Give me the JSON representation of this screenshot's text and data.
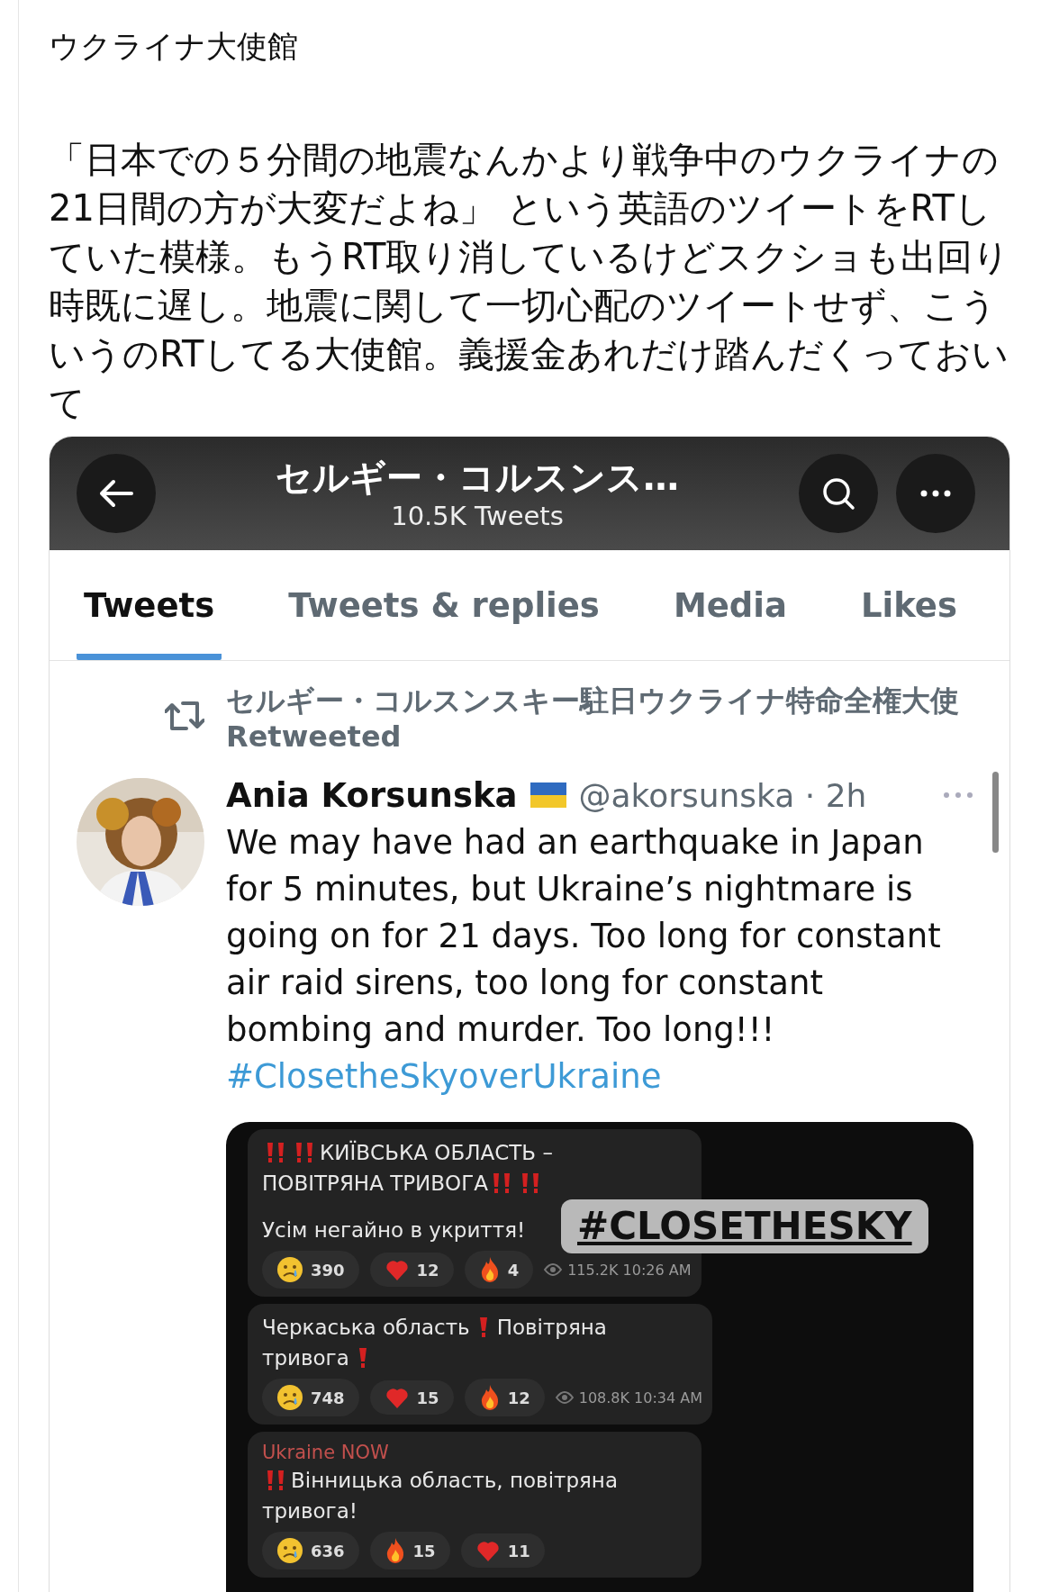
{
  "post": {
    "author": "ウクライナ大使館",
    "body": "「日本での５分間の地震なんかより戦争中のウクライナの21日間の方が大変だよね」 という英語のツイートをRTしていた模様。もうRT取り消しているけどスクショも出回り時既に遅し。地震に関して一切心配のツイートせず、こういうのRTしてる大使館。義援金あれだけ踏んだくっておいて"
  },
  "screenshot": {
    "header": {
      "title": "セルギー・コルスンス…",
      "subtitle": "10.5K Tweets"
    },
    "tabs": [
      {
        "label": "Tweets",
        "selected": true
      },
      {
        "label": "Tweets & replies",
        "selected": false
      },
      {
        "label": "Media",
        "selected": false
      },
      {
        "label": "Likes",
        "selected": false
      }
    ],
    "retweet_note": "セルギー・コルスンスキー駐日ウクライナ特命全権大使 Retweeted",
    "tweet": {
      "name": "Ania Korsunska",
      "handle": "@akorsunska · 2h",
      "text": "We may have had an earthquake in Japan for 5 minutes, but Ukraine’s nightmare is going on for 21 days. Too long for constant air raid sirens, too long for constant bombing and murder. Too long!!!",
      "hashtag": "#ClosetheSkyoverUkraine",
      "media": {
        "sticker": "#CLOSETHESKY",
        "messages": [
          {
            "lines": [
              [
                {
                  "kind": "double-alert"
                },
                {
                  "kind": "double-alert"
                },
                {
                  "kind": "text",
                  "text": "КИЇВСЬКА ОБЛАСТЬ –"
                }
              ],
              [
                {
                  "kind": "text",
                  "text": "ПОВІТРЯНА ТРИВОГА"
                },
                {
                  "kind": "double-alert"
                },
                {
                  "kind": "double-alert"
                }
              ]
            ],
            "note": "Усім негайно в укриття!",
            "reactions": [
              {
                "kind": "crying",
                "count": "390"
              },
              {
                "kind": "heart",
                "count": "12"
              },
              {
                "kind": "fire",
                "count": "4"
              }
            ],
            "meta": "115.2K 10:26 AM"
          },
          {
            "lines": [
              [
                {
                  "kind": "text",
                  "text": "Черкаська область"
                },
                {
                  "kind": "single-alert"
                },
                {
                  "kind": "text",
                  "text": "Повітряна"
                }
              ],
              [
                {
                  "kind": "text",
                  "text": "тривога"
                },
                {
                  "kind": "single-alert"
                }
              ]
            ],
            "reactions": [
              {
                "kind": "crying",
                "count": "748"
              },
              {
                "kind": "heart",
                "count": "15"
              },
              {
                "kind": "fire",
                "count": "12"
              }
            ],
            "meta": "108.8K 10:34 AM"
          },
          {
            "channel": "Ukraine NOW",
            "lines": [
              [
                {
                  "kind": "double-alert"
                },
                {
                  "kind": "text",
                  "text": "Вінницька область, повітряна"
                }
              ],
              [
                {
                  "kind": "text",
                  "text": "тривога!"
                }
              ]
            ],
            "reactions": [
              {
                "kind": "crying",
                "count": "636"
              },
              {
                "kind": "fire",
                "count": "15"
              },
              {
                "kind": "heart",
                "count": "11"
              }
            ]
          }
        ]
      }
    }
  }
}
